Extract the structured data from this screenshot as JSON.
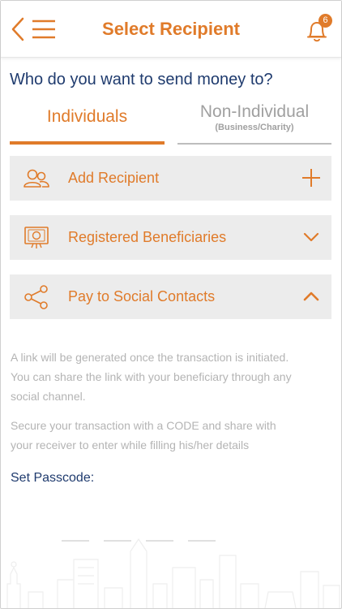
{
  "header": {
    "title": "Select Recipient",
    "notification_count": "6"
  },
  "question": "Who do you want to send money to?",
  "tabs": [
    {
      "label": "Individuals",
      "sublabel": "",
      "active": true
    },
    {
      "label": "Non-Individual",
      "sublabel": "(Business/Charity)",
      "active": false
    }
  ],
  "options": [
    {
      "label": "Add Recipient",
      "icon": "users-icon",
      "action_icon": "plus-icon"
    },
    {
      "label": "Registered Beneficiaries",
      "icon": "beneficiary-icon",
      "action_icon": "chevron-down-icon"
    },
    {
      "label": "Pay to Social Contacts",
      "icon": "share-icon",
      "action_icon": "chevron-up-icon"
    }
  ],
  "info_lines": [
    "A link will be generated once the transaction is initiated.",
    "You can share the link with your beneficiary through any",
    "social channel."
  ],
  "secure_lines": [
    "Secure your transaction with a CODE and share with",
    "your receiver to enter while filling his/her details"
  ],
  "passcode": {
    "label": "Set Passcode:",
    "digits": [
      "",
      "",
      "",
      ""
    ]
  },
  "colors": {
    "accent": "#e07b2a",
    "navy": "#1f3b6e",
    "row_bg": "#ececec",
    "muted": "#b4b4b4"
  }
}
